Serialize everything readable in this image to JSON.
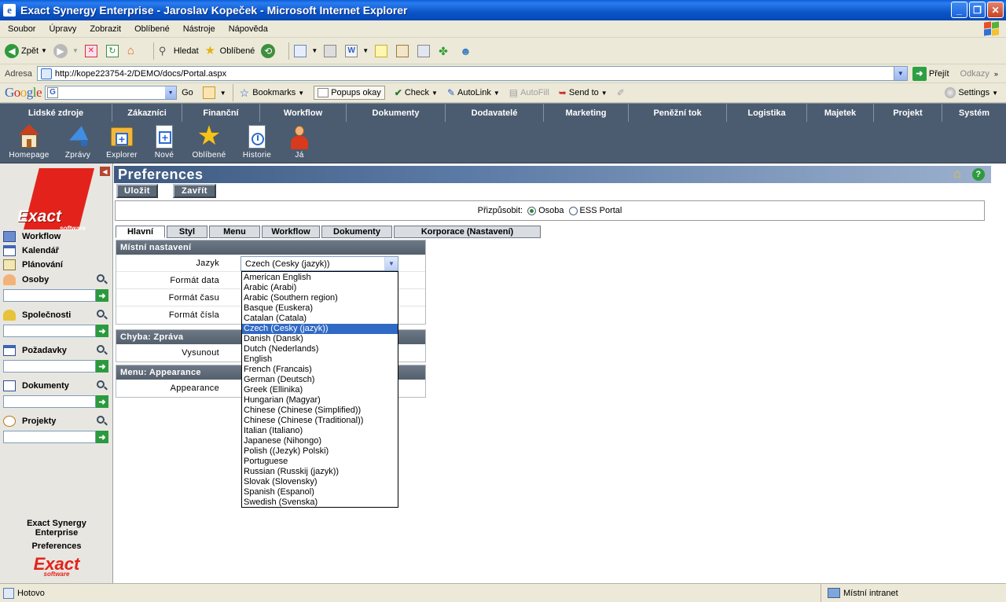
{
  "window": {
    "title": "Exact Synergy Enterprise - Jaroslav Kopeček - Microsoft Internet Explorer"
  },
  "menubar": {
    "items": [
      "Soubor",
      "Úpravy",
      "Zobrazit",
      "Oblíbené",
      "Nástroje",
      "Nápověda"
    ]
  },
  "toolbar": {
    "back": "Zpět",
    "search": "Hledat",
    "favorites": "Oblíbené"
  },
  "address": {
    "label": "Adresa",
    "url": "http://kope223754-2/DEMO/docs/Portal.aspx",
    "go": "Přejít",
    "links": "Odkazy"
  },
  "googlebar": {
    "logo": "Google",
    "go": "Go",
    "bookmarks": "Bookmarks",
    "popups": "Popups okay",
    "check": "Check",
    "autolink": "AutoLink",
    "autofill": "AutoFill",
    "sendto": "Send to",
    "settings": "Settings"
  },
  "appnav": {
    "tabs": [
      "Lidské zdroje",
      "Zákazníci",
      "Finanční",
      "Workflow",
      "Dokumenty",
      "Dodavatelé",
      "Marketing",
      "Peněžní tok",
      "Logistika",
      "Majetek",
      "Projekt",
      "Systém"
    ]
  },
  "iconstrip": {
    "items": [
      "Homepage",
      "Zprávy",
      "Explorer",
      "Nové",
      "Oblíbené",
      "Historie",
      "Já"
    ]
  },
  "leftpanel": {
    "logo_text": "Exact",
    "logo_sub": "software",
    "links": [
      "Workflow",
      "Kalendář",
      "Plánování"
    ],
    "search_sections": [
      "Osoby",
      "Společnosti",
      "Požadavky",
      "Dokumenty",
      "Projekty"
    ],
    "footer_line1": "Exact Synergy",
    "footer_line2": "Enterprise",
    "footer_line3": "Preferences"
  },
  "page": {
    "title": "Preferences",
    "save": "Uložit",
    "close": "Zavřít",
    "personalize_label": "Přizpůsobit:",
    "radio_person": "Osoba",
    "radio_ess": "ESS Portal",
    "radio_selected": "Osoba"
  },
  "subtabs": [
    "Hlavní",
    "Styl",
    "Menu",
    "Workflow",
    "Dokumenty",
    "Korporace (Nastavení)"
  ],
  "sections": {
    "local": {
      "title": "Místní nastavení",
      "language": "Jazyk",
      "date_format": "Formát data",
      "time_format": "Formát času",
      "number_format": "Formát čísla"
    },
    "error": {
      "title": "Chyba: Zpráva",
      "popup": "Vysunout"
    },
    "menu": {
      "title": "Menu: Appearance",
      "appearance": "Appearance"
    }
  },
  "language_select": {
    "value": "Czech (Cesky (jazyk))",
    "options": [
      "American English",
      "Arabic (Arabi)",
      "Arabic (Southern region)",
      "Basque (Euskera)",
      "Catalan (Catala)",
      "Czech (Cesky (jazyk))",
      "Danish (Dansk)",
      "Dutch (Nederlands)",
      "English",
      "French (Francais)",
      "German (Deutsch)",
      "Greek (Ellinika)",
      "Hungarian (Magyar)",
      "Chinese (Chinese (Simplified))",
      "Chinese (Chinese (Traditional))",
      "Italian (Italiano)",
      "Japanese (Nihongo)",
      "Polish ((Jezyk) Polski)",
      "Portuguese",
      "Russian (Russkij (jazyk))",
      "Slovak (Slovensky)",
      "Spanish (Espanol)",
      "Swedish (Svenska)"
    ],
    "selected_index": 5
  },
  "status": {
    "left": "Hotovo",
    "zone": "Místní intranet"
  }
}
